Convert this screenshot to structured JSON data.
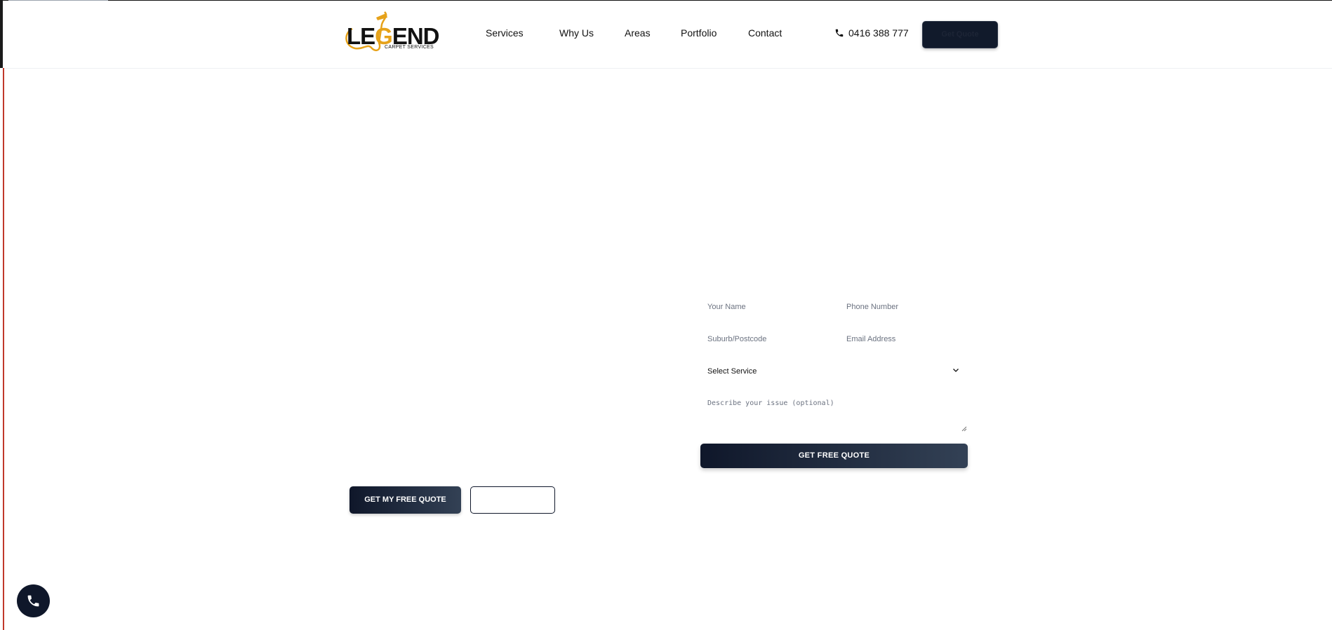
{
  "header": {
    "logo": {
      "word": "LEGEND",
      "subtitle": "CARPET SERVICES"
    },
    "nav": [
      "Services",
      "Why Us",
      "Areas",
      "Portfolio",
      "Contact"
    ],
    "phone": "0416 388 777",
    "cta_label": "Get Quote"
  },
  "form": {
    "name_placeholder": "Your Name",
    "phone_placeholder": "Phone Number",
    "suburb_placeholder": "Suburb/Postcode",
    "email_placeholder": "Email Address",
    "service_select": "Select Service",
    "issue_placeholder": "Describe your issue (optional)",
    "submit_label": "GET FREE QUOTE"
  },
  "hero": {
    "primary_cta": "GET MY FREE QUOTE",
    "secondary_cta": ""
  },
  "icons": {
    "phone": "phone-icon",
    "chevron": "chevron-down-icon",
    "floating": "phone-icon"
  },
  "colors": {
    "brand_dark": "#0f172a",
    "accent_gold": "#e6a21a"
  }
}
